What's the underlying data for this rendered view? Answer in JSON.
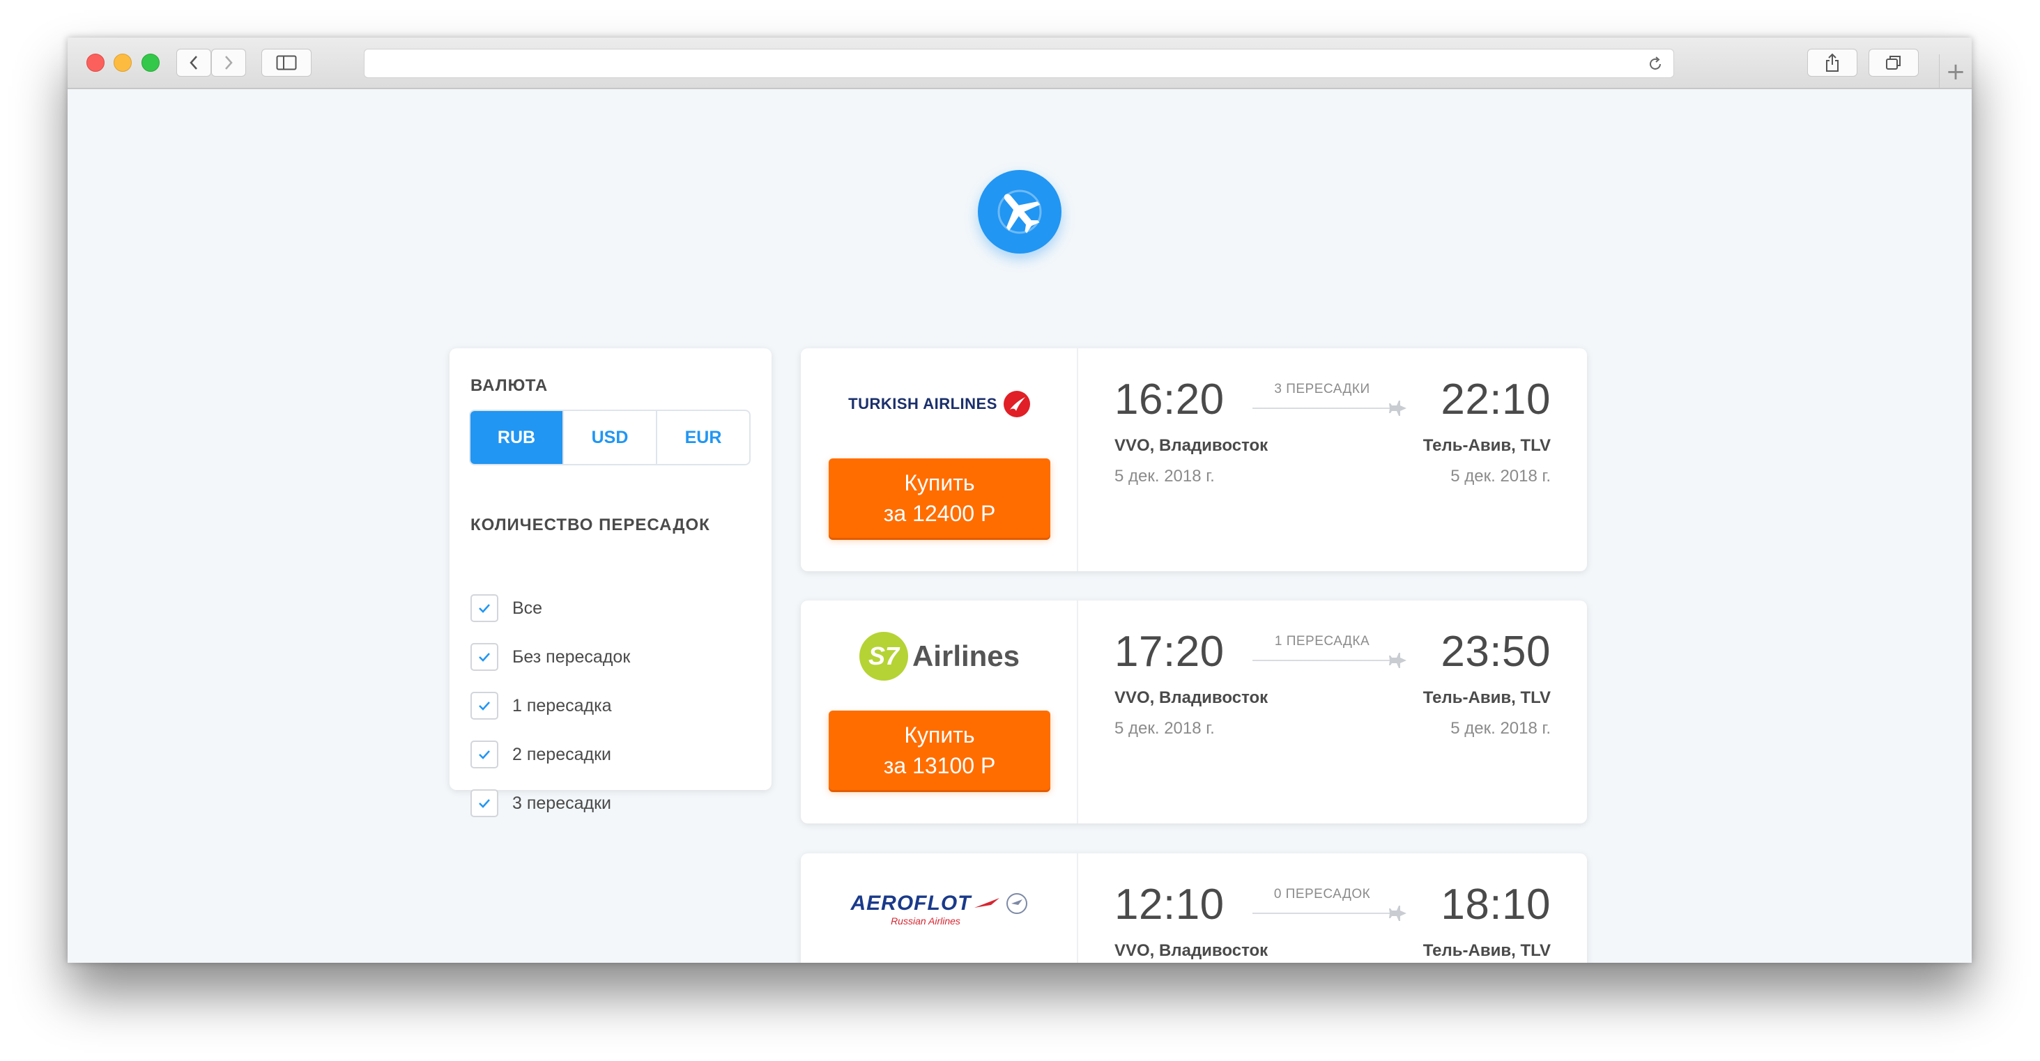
{
  "filters": {
    "currency_title": "ВАЛЮТА",
    "currencies": [
      "RUB",
      "USD",
      "EUR"
    ],
    "selected_currency": "RUB",
    "stops_title": "КОЛИЧЕСТВО ПЕРЕСАДОК",
    "stop_options": [
      {
        "label": "Все",
        "checked": true
      },
      {
        "label": "Без пересадок",
        "checked": true
      },
      {
        "label": "1 пересадка",
        "checked": true
      },
      {
        "label": "2 пересадки",
        "checked": true
      },
      {
        "label": "3 пересадки",
        "checked": true
      }
    ]
  },
  "tickets": [
    {
      "airline": "TURKISH AIRLINES",
      "buy_line1": "Купить",
      "buy_line2": "за 12400 Р",
      "departure_time": "16:20",
      "arrival_time": "22:10",
      "stops": "3 ПЕРЕСАДКИ",
      "origin": "VVO, Владивосток",
      "destination": "Тель-Авив, TLV",
      "departure_date": "5 дек. 2018 г.",
      "arrival_date": "5 дек. 2018 г."
    },
    {
      "airline": "S7 Airlines",
      "airline_mark": "S7",
      "airline_word": "Airlines",
      "buy_line1": "Купить",
      "buy_line2": "за 13100 Р",
      "departure_time": "17:20",
      "arrival_time": "23:50",
      "stops": "1 ПЕРЕСАДКА",
      "origin": "VVO, Владивосток",
      "destination": "Тель-Авив, TLV",
      "departure_date": "5 дек. 2018 г.",
      "arrival_date": "5 дек. 2018 г."
    },
    {
      "airline": "AEROFLOT",
      "airline_sub": "Russian Airlines",
      "departure_time": "12:10",
      "arrival_time": "18:10",
      "stops": "0 ПЕРЕСАДОК",
      "origin": "VVO, Владивосток",
      "destination": "Тель-Авив, TLV"
    }
  ],
  "colors": {
    "accent": "#2196f3",
    "buy_button": "#ff6d00",
    "background": "#f3f7fa"
  },
  "icons": {
    "logo": "airplane-icon",
    "check": "check-icon",
    "route": "plane-icon"
  }
}
